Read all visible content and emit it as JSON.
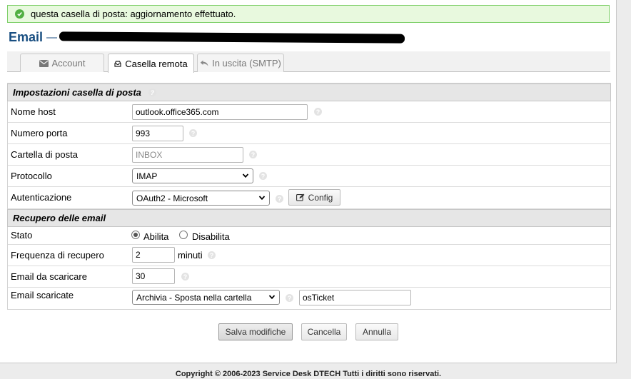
{
  "notice": {
    "text": "questa casella di posta: aggiornamento effettuato."
  },
  "header": {
    "title": "Email",
    "separator": "—"
  },
  "tabs": [
    {
      "label": "Account",
      "icon": "envelope-icon"
    },
    {
      "label": "Casella remota",
      "icon": "inbox-icon"
    },
    {
      "label": "In uscita (SMTP)",
      "icon": "reply-icon"
    }
  ],
  "sections": {
    "mailbox_settings": "Impostazioni casella di posta",
    "fetching": "Recupero delle email"
  },
  "fields": {
    "host": {
      "label": "Nome host",
      "value": "outlook.office365.com"
    },
    "port": {
      "label": "Numero porta",
      "value": "993"
    },
    "folder": {
      "label": "Cartella di posta",
      "placeholder": "INBOX"
    },
    "protocol": {
      "label": "Protocollo",
      "value": "IMAP"
    },
    "auth": {
      "label": "Autenticazione",
      "value": "OAuth2 - Microsoft",
      "config_label": "Config"
    },
    "status": {
      "label": "Stato",
      "options": [
        "Abilita",
        "Disabilita"
      ],
      "selected": "Abilita"
    },
    "frequency": {
      "label": "Frequenza di recupero",
      "value": "2",
      "unit": "minuti"
    },
    "fetch_count": {
      "label": "Email da scaricare",
      "value": "30"
    },
    "downloaded": {
      "label": "Email scaricate",
      "value": "Archivia - Sposta nella cartella",
      "folder": "osTicket"
    }
  },
  "buttons": {
    "save": "Salva modifiche",
    "reset": "Cancella",
    "cancel": "Annulla"
  },
  "footer": "Copyright © 2006-2023 Service Desk DTECH Tutti i diritti sono riservati.",
  "colors": {
    "title": "#184e81",
    "success_bg": "#e8f9de",
    "success_border": "#7fd06a"
  }
}
